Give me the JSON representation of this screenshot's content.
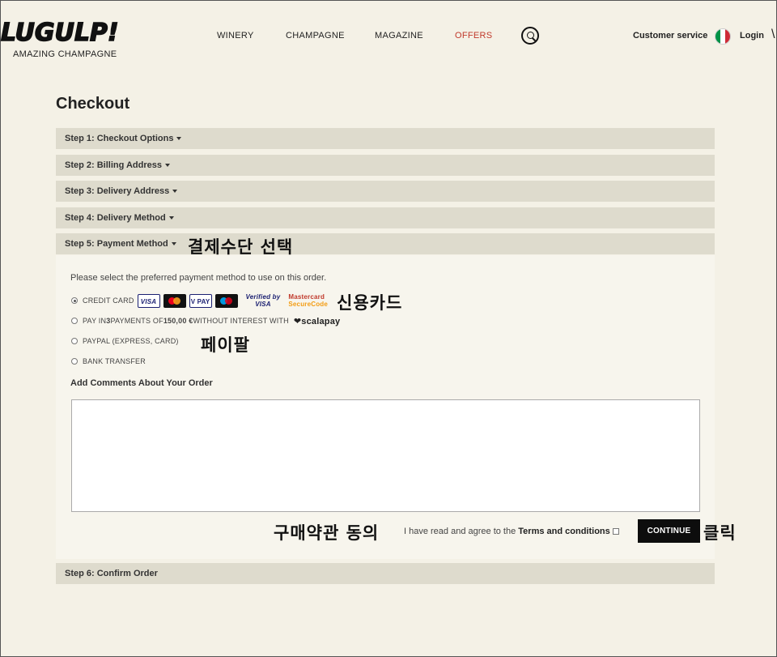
{
  "header": {
    "logo_text": "LUGULP!",
    "logo_sub": "AMAZING CHAMPAGNE",
    "nav": [
      "WINERY",
      "CHAMPAGNE",
      "MAGAZINE",
      "OFFERS"
    ],
    "customer_service": "Customer service",
    "login": "Login",
    "accent_color": "#c0392b"
  },
  "page_title": "Checkout",
  "steps": {
    "s1": "Step 1: Checkout Options",
    "s2": "Step 2: Billing Address",
    "s3": "Step 3: Delivery Address",
    "s4": "Step 4: Delivery Method",
    "s5": "Step 5: Payment Method",
    "s6": "Step 6: Confirm Order"
  },
  "payment": {
    "intro": "Please select the preferred payment method to use on this order.",
    "credit_card": "CREDIT CARD",
    "cards": {
      "visa": "VISA",
      "vpay": "V PAY",
      "verified_1": "Verified by",
      "verified_2": "VISA",
      "mc_1": "Mastercard",
      "mc_2": "SecureCode"
    },
    "pay_in_prefix": "PAY IN ",
    "pay_in_count": "3",
    "pay_in_mid": " PAYMENTS OF ",
    "pay_in_amount": "150,00 €",
    "pay_in_suffix": " WITHOUT INTEREST WITH",
    "scalapay": "❤scalapay",
    "paypal": "PAYPAL (EXPRESS, CARD)",
    "bank": "BANK TRANSFER"
  },
  "comments_label": "Add Comments About Your Order",
  "agree_text": "I have read and agree to the ",
  "terms_link": "Terms and conditions",
  "continue_label": "CONTINUE",
  "annotations": {
    "payment_select": "결제수단 선택",
    "credit_card": "신용카드",
    "paypal": "페이팔",
    "terms_agree": "구매약관 동의",
    "click": "클릭"
  }
}
